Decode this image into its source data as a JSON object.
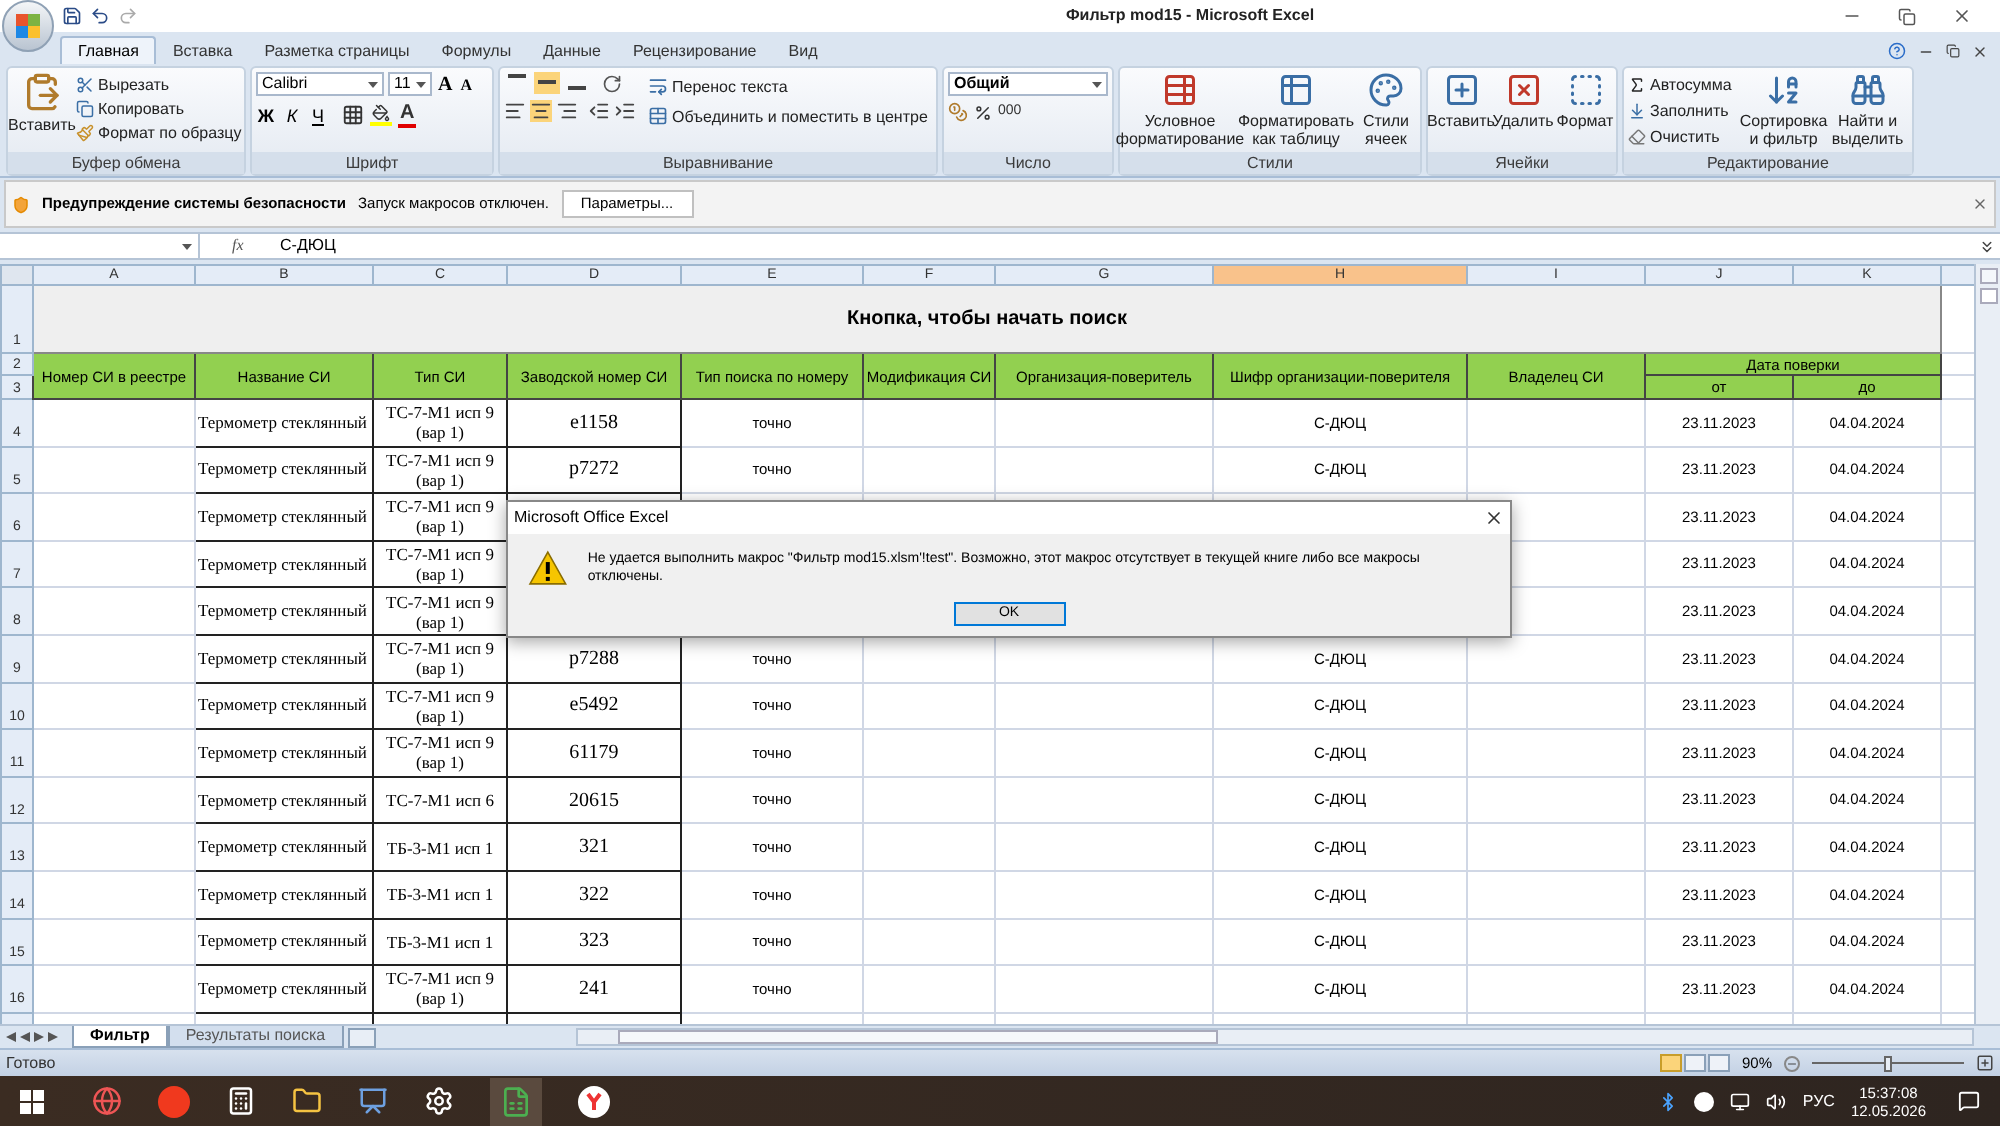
{
  "window": {
    "title": "Фильтр mod15 - Microsoft Excel"
  },
  "tabs": [
    {
      "label": "Главная",
      "selected": true
    },
    {
      "label": "Вставка",
      "selected": false
    },
    {
      "label": "Разметка страницы",
      "selected": false
    },
    {
      "label": "Формулы",
      "selected": false
    },
    {
      "label": "Данные",
      "selected": false
    },
    {
      "label": "Рецензирование",
      "selected": false
    },
    {
      "label": "Вид",
      "selected": false
    }
  ],
  "ribbon": {
    "clipboard": {
      "name": "Буфер обмена",
      "paste": "Вставить",
      "items": [
        "Вырезать",
        "Копировать",
        "Формат по образцу"
      ]
    },
    "font": {
      "name": "Шрифт",
      "family": "Calibri",
      "size": "11",
      "grow": "A",
      "shrink": "A",
      "styles": [
        "Ж",
        "К",
        "Ч"
      ],
      "color_button": "A"
    },
    "alignment": {
      "name": "Выравнивание",
      "wrap": "Перенос текста",
      "merge": "Объединить и поместить в центре"
    },
    "number": {
      "name": "Число",
      "format": "Общий",
      "thousands": "000"
    },
    "styles": {
      "name": "Стили",
      "buttons": [
        "Условное\nформатирование",
        "Форматировать\nкак таблицу",
        "Стили\nячеек"
      ]
    },
    "cells": {
      "name": "Ячейки",
      "buttons": [
        "Вставить",
        "Удалить",
        "Формат"
      ]
    },
    "editing": {
      "name": "Редактирование",
      "items": [
        "Автосумма",
        "Заполнить",
        "Очистить"
      ],
      "buttons": [
        "Сортировка\nи фильтр",
        "Найти и\nвыделить"
      ]
    }
  },
  "security_bar": {
    "title": "Предупреждение системы безопасности",
    "message": "Запуск макросов отключен.",
    "button": "Параметры..."
  },
  "formula_bar": {
    "fx": "fx",
    "formula": "С-ДЮЦ"
  },
  "sheet": {
    "columns": [
      {
        "letter": "A",
        "selected": false
      },
      {
        "letter": "B",
        "selected": false
      },
      {
        "letter": "C",
        "selected": false
      },
      {
        "letter": "D",
        "selected": false
      },
      {
        "letter": "E",
        "selected": false
      },
      {
        "letter": "F",
        "selected": false
      },
      {
        "letter": "G",
        "selected": false
      },
      {
        "letter": "H",
        "selected": true
      },
      {
        "letter": "I",
        "selected": false
      },
      {
        "letter": "J",
        "selected": false
      },
      {
        "letter": "K",
        "selected": false
      }
    ],
    "title": "Кнопка, чтобы начать поиск",
    "header_row_numbers": [
      "1",
      "2",
      "3"
    ],
    "headers": [
      "Номер СИ в реестре",
      "Название СИ",
      "Тип СИ",
      "Заводской номер СИ",
      "Тип поиска по номеру",
      "Модификация СИ",
      "Организация-поверитель",
      "Шифр организации-поверителя",
      "Владелец СИ"
    ],
    "date_header": "Дата поверки",
    "date_from": "от",
    "date_to": "до",
    "rows": [
      {
        "num": "4",
        "name": "Термометр стеклянный",
        "type": "ТС-7-М1 исп 9 (вар 1)",
        "serial": "e1158",
        "search": "точно",
        "code": "С-ДЮЦ",
        "from": "23.11.2023",
        "to": "04.04.2024"
      },
      {
        "num": "5",
        "name": "Термометр стеклянный",
        "type": "ТС-7-М1 исп 9 (вар 1)",
        "serial": "p7272",
        "search": "точно",
        "code": "С-ДЮЦ",
        "from": "23.11.2023",
        "to": "04.04.2024"
      },
      {
        "num": "6",
        "name": "Термометр стеклянный",
        "type": "ТС-7-М1 исп 9 (вар 1)",
        "from": "23.11.2023",
        "to": "04.04.2024"
      },
      {
        "num": "7",
        "name": "Термометр стеклянный",
        "type": "ТС-7-М1 исп 9 (вар 1)",
        "from": "23.11.2023",
        "to": "04.04.2024"
      },
      {
        "num": "8",
        "name": "Термометр стеклянный",
        "type": "ТС-7-М1 исп 9 (вар 1)",
        "from": "23.11.2023",
        "to": "04.04.2024"
      },
      {
        "num": "9",
        "name": "Термометр стеклянный",
        "type": "ТС-7-М1 исп 9 (вар 1)",
        "serial": "p7288",
        "search": "точно",
        "code": "С-ДЮЦ",
        "from": "23.11.2023",
        "to": "04.04.2024"
      },
      {
        "num": "10",
        "name": "Термометр стеклянный",
        "type": "ТС-7-М1 исп 9 (вар 1)",
        "serial": "e5492",
        "search": "точно",
        "code": "С-ДЮЦ",
        "from": "23.11.2023",
        "to": "04.04.2024"
      },
      {
        "num": "11",
        "name": "Термометр стеклянный",
        "type": "ТС-7-М1 исп 9 (вар 1)",
        "serial": "61179",
        "search": "точно",
        "code": "С-ДЮЦ",
        "from": "23.11.2023",
        "to": "04.04.2024"
      },
      {
        "num": "12",
        "name": "Термометр стеклянный",
        "type": "ТС-7-М1 исп 6",
        "serial": "20615",
        "search": "точно",
        "code": "С-ДЮЦ",
        "from": "23.11.2023",
        "to": "04.04.2024"
      },
      {
        "num": "13",
        "name": "Термометр стеклянный",
        "type": "ТБ-3-М1 исп 1",
        "serial": "321",
        "search": "точно",
        "code": "С-ДЮЦ",
        "from": "23.11.2023",
        "to": "04.04.2024"
      },
      {
        "num": "14",
        "name": "Термометр стеклянный",
        "type": "ТБ-3-М1 исп 1",
        "serial": "322",
        "search": "точно",
        "code": "С-ДЮЦ",
        "from": "23.11.2023",
        "to": "04.04.2024"
      },
      {
        "num": "15",
        "name": "Термометр стеклянный",
        "type": "ТБ-3-М1 исп 1",
        "serial": "323",
        "search": "точно",
        "code": "С-ДЮЦ",
        "from": "23.11.2023",
        "to": "04.04.2024"
      },
      {
        "num": "16",
        "name": "Термометр стеклянный",
        "type": "ТС-7-М1 исп 9 (вар 1)",
        "serial": "241",
        "search": "точно",
        "code": "С-ДЮЦ",
        "from": "23.11.2023",
        "to": "04.04.2024"
      }
    ]
  },
  "dialog": {
    "title": "Microsoft Office Excel",
    "message": "Не удается выполнить макрос \"Фильтр mod15.xlsm'!test\". Возможно, этот макрос отсутствует в текущей книге либо все макросы отключены.",
    "button": "OK"
  },
  "sheet_tabs": [
    {
      "label": "Фильтр",
      "selected": true
    },
    {
      "label": "Результаты поиска",
      "selected": false
    }
  ],
  "status_bar": {
    "status": "Готово",
    "zoom": "90%",
    "zoom_slider": {
      "level": 0.5
    }
  },
  "taskbar": {
    "lang": "РУС",
    "time": "15:37:08",
    "date": "12.05.2026"
  }
}
